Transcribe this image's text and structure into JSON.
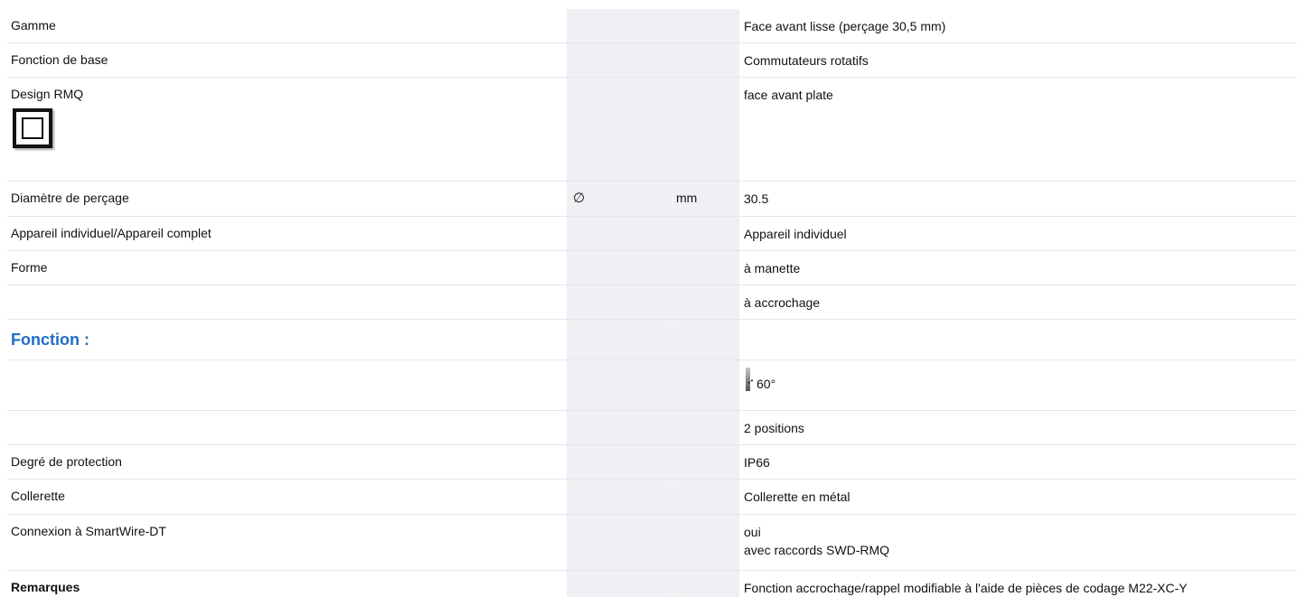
{
  "rows": [
    {
      "label": "Gamme",
      "symbol": "",
      "unit": "",
      "value": "Face avant lisse (perçage 30,5 mm)"
    },
    {
      "label": "Fonction de base",
      "symbol": "",
      "unit": "",
      "value": "Commutateurs rotatifs"
    },
    {
      "label": "Design RMQ",
      "symbol": "",
      "unit": "",
      "value": "face avant plate",
      "icon": "rmq-flat-bezel-icon"
    },
    {
      "label": "Diamètre de perçage",
      "symbol": "∅",
      "unit": "mm",
      "value": "30.5"
    },
    {
      "label": "Appareil individuel/Appareil complet",
      "symbol": "",
      "unit": "",
      "value": "Appareil individuel"
    },
    {
      "label": "Forme",
      "symbol": "",
      "unit": "",
      "value": "à manette"
    },
    {
      "label": "",
      "symbol": "",
      "unit": "",
      "value": "à accrochage"
    },
    {
      "section_title": "Fonction :"
    },
    {
      "label": "",
      "symbol": "",
      "unit": "",
      "value": "60°",
      "icon": "rotation-angle-icon"
    },
    {
      "label": "",
      "symbol": "",
      "unit": "",
      "value": "2 positions"
    },
    {
      "label": "Degré de protection",
      "symbol": "",
      "unit": "",
      "value": "IP66"
    },
    {
      "label": "Collerette",
      "symbol": "",
      "unit": "",
      "value": "Collerette en métal"
    },
    {
      "label": "Connexion à SmartWire-DT",
      "symbol": "",
      "unit": "",
      "value": "oui",
      "value2": "avec raccords SWD-RMQ"
    },
    {
      "label": "Remarques",
      "symbol": "",
      "unit": "",
      "value": "Fonction accrochage/rappel modifiable à l'aide de pièces de codage M22-XC-Y",
      "bold_label": true
    }
  ],
  "colors": {
    "section_title": "#1f6fc5",
    "shaded_column": "#eef0f3",
    "row_border": "#e4e6ea"
  }
}
